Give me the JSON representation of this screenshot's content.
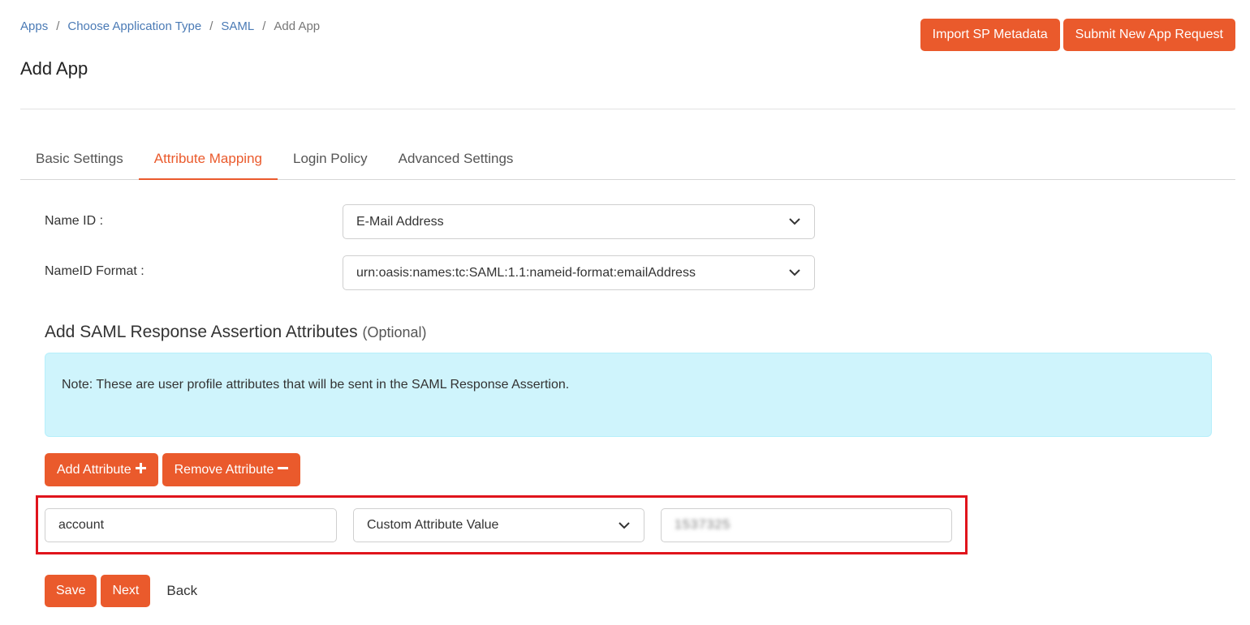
{
  "breadcrumb": {
    "items": [
      "Apps",
      "Choose Application Type",
      "SAML"
    ],
    "current": "Add App",
    "separator": "/"
  },
  "page_title": "Add App",
  "header_buttons": {
    "import": "Import SP Metadata",
    "submit": "Submit New App Request"
  },
  "tabs": [
    {
      "label": "Basic Settings",
      "active": false
    },
    {
      "label": "Attribute Mapping",
      "active": true
    },
    {
      "label": "Login Policy",
      "active": false
    },
    {
      "label": "Advanced Settings",
      "active": false
    }
  ],
  "form": {
    "name_id": {
      "label": "Name ID :",
      "value": "E-Mail Address"
    },
    "nameid_format": {
      "label": "NameID Format :",
      "value": "urn:oasis:names:tc:SAML:1.1:nameid-format:emailAddress"
    }
  },
  "assertion": {
    "heading": "Add SAML Response Assertion Attributes",
    "optional": "(Optional)",
    "note": "Note: These are user profile attributes that will be sent in the SAML Response Assertion.",
    "add_button": "Add Attribute",
    "remove_button": "Remove Attribute"
  },
  "attribute_row": {
    "name": "account",
    "type": "Custom Attribute Value",
    "value": "1537325"
  },
  "footer": {
    "save": "Save",
    "next": "Next",
    "back": "Back"
  },
  "colors": {
    "accent": "#ea5a2c",
    "link": "#4a7ab5",
    "note_bg": "#cff4fc",
    "highlight": "#e0141c"
  }
}
